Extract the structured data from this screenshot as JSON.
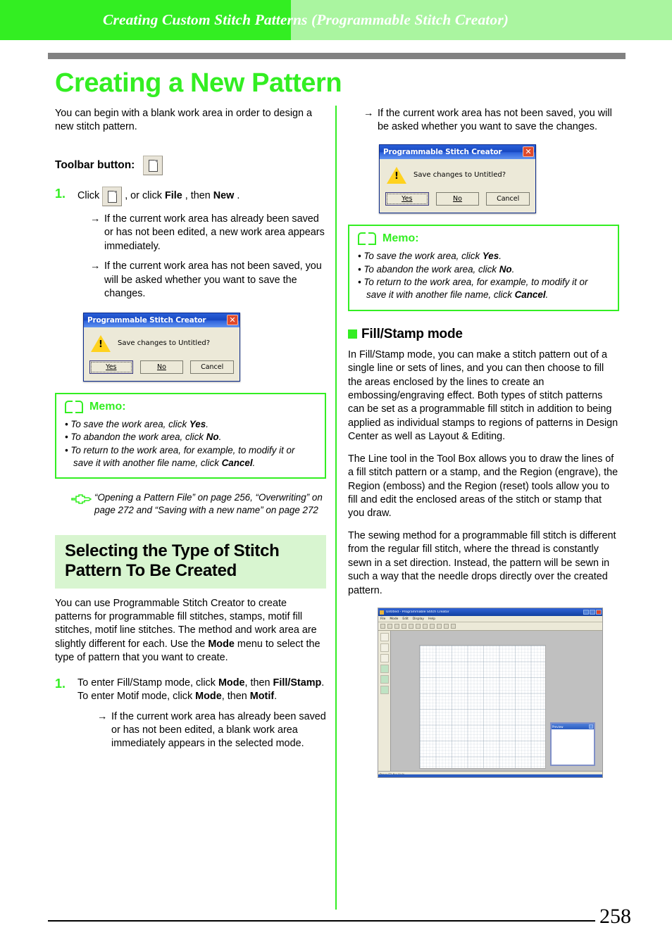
{
  "header": {
    "running_title": "Creating Custom Stitch Patterns (Programmable Stitch Creator)",
    "band_left_color": "#33ee22",
    "band_right_color": "#aaf5a0",
    "rule_color": "#818181"
  },
  "page_title": "Creating a New Pattern",
  "accent_green": "#33ee22",
  "left": {
    "intro": "You can begin with a blank work area in order to design a new stitch pattern.",
    "toolbar_label": "Toolbar button:",
    "toolbar_icon": "new-document-icon",
    "step1_num": "1.",
    "step1_click": "Click",
    "step1_mid": ", or click",
    "step1_file": "File",
    "step1_then": ", then",
    "step1_new": "New",
    "step1_end": ".",
    "arrow1": "If the current work area has already been saved or has not been edited, a new work area appears immediately.",
    "arrow2": "If the current work area has not been saved, you will be asked whether you want to save the changes.",
    "dialog": {
      "title": "Programmable Stitch Creator",
      "close_icon": "close-icon",
      "warning_icon": "warning-triangle-icon",
      "message": "Save changes to Untitled?",
      "btn_yes": "Yes",
      "btn_yes_mnemonic": "Y",
      "btn_no": "No",
      "btn_no_mnemonic": "N",
      "btn_cancel": "Cancel"
    },
    "memo": {
      "icon": "open-book-icon",
      "title": "Memo:",
      "items": [
        {
          "pre": "To save the work area, click ",
          "bold": "Yes",
          "post": "."
        },
        {
          "pre": "To abandon the work area, click ",
          "bold": "No",
          "post": "."
        },
        {
          "pre": "To return to the work area, for example, to modify it or save it with another file name, click ",
          "bold": "Cancel",
          "post": "."
        }
      ]
    },
    "seealso": {
      "icon": "pointing-hand-icon",
      "text": "“Opening a Pattern File” on page 256, “Overwriting” on page 272 and “Saving with a new name” on page 272"
    },
    "section_heading": "Selecting the Type of Stitch Pattern To Be Created",
    "section_heading_bg": "#d8f5d0",
    "section_para_1": "You can use Programmable Stitch Creator to create patterns for programmable fill stitches, stamps, motif fill stitches, motif line stitches. The method and work area are slightly different for each. Use the ",
    "section_para_mode": "Mode",
    "section_para_2": " menu to select the type of pattern that you want to create.",
    "step2_num": "1.",
    "step2_line1_a": "To enter Fill/Stamp mode, click ",
    "step2_line1_mode": "Mode",
    "step2_line1_b": ", then ",
    "step2_line1_fillstamp": "Fill/Stamp",
    "step2_line1_c": ".",
    "step2_line2_a": "To enter Motif mode, click ",
    "step2_line2_mode": "Mode",
    "step2_line2_b": ", then ",
    "step2_line2_motif": "Motif",
    "step2_line2_c": ".",
    "step2_arrow": "If the current work area has already been saved or has not been edited, a blank work area immediately appears in the selected mode."
  },
  "right": {
    "arrow1": "If the current work area has not been saved, you will be asked whether you want to save the changes.",
    "dialog": {
      "title": "Programmable Stitch Creator",
      "close_icon": "close-icon",
      "warning_icon": "warning-triangle-icon",
      "message": "Save changes to Untitled?",
      "btn_yes": "Yes",
      "btn_no": "No",
      "btn_cancel": "Cancel"
    },
    "memo": {
      "icon": "open-book-icon",
      "title": "Memo:",
      "items": [
        {
          "pre": "To save the work area, click ",
          "bold": "Yes",
          "post": "."
        },
        {
          "pre": "To abandon the work area, click ",
          "bold": "No",
          "post": "."
        },
        {
          "pre": "To return to the work area, for example, to modify it or save it with another file name, click ",
          "bold": "Cancel",
          "post": "."
        }
      ]
    },
    "subhead": "Fill/Stamp mode",
    "para1": "In Fill/Stamp mode, you can make a stitch pattern out of a single line or sets of lines, and you can then choose to fill the areas enclosed by the lines to create an embossing/engraving effect. Both types of stitch patterns can be set as a programmable fill stitch in addition to being applied as individual stamps to regions of patterns in Design Center as well as Layout & Editing.",
    "para2": "The Line tool in the Tool Box allows you to draw the lines of a fill stitch pattern or a stamp, and the Region (engrave), the Region (emboss) and the Region (reset) tools allow you to fill and edit the enclosed areas of the stitch or stamp that you draw.",
    "para3": "The sewing method for a programmable fill stitch is different from the regular fill stitch, where the thread is constantly sewn in a set direction. Instead, the pattern will be sewn in such a way that the needle drops directly over the created pattern.",
    "appshot": {
      "window_title": "Untitled - Programmable Stitch Creator",
      "menus": [
        "File",
        "Mode",
        "Edit",
        "Display",
        "Help"
      ],
      "preview_title": "Preview",
      "status": "Press F1 for Help"
    }
  },
  "footer": {
    "page_number": "258"
  }
}
